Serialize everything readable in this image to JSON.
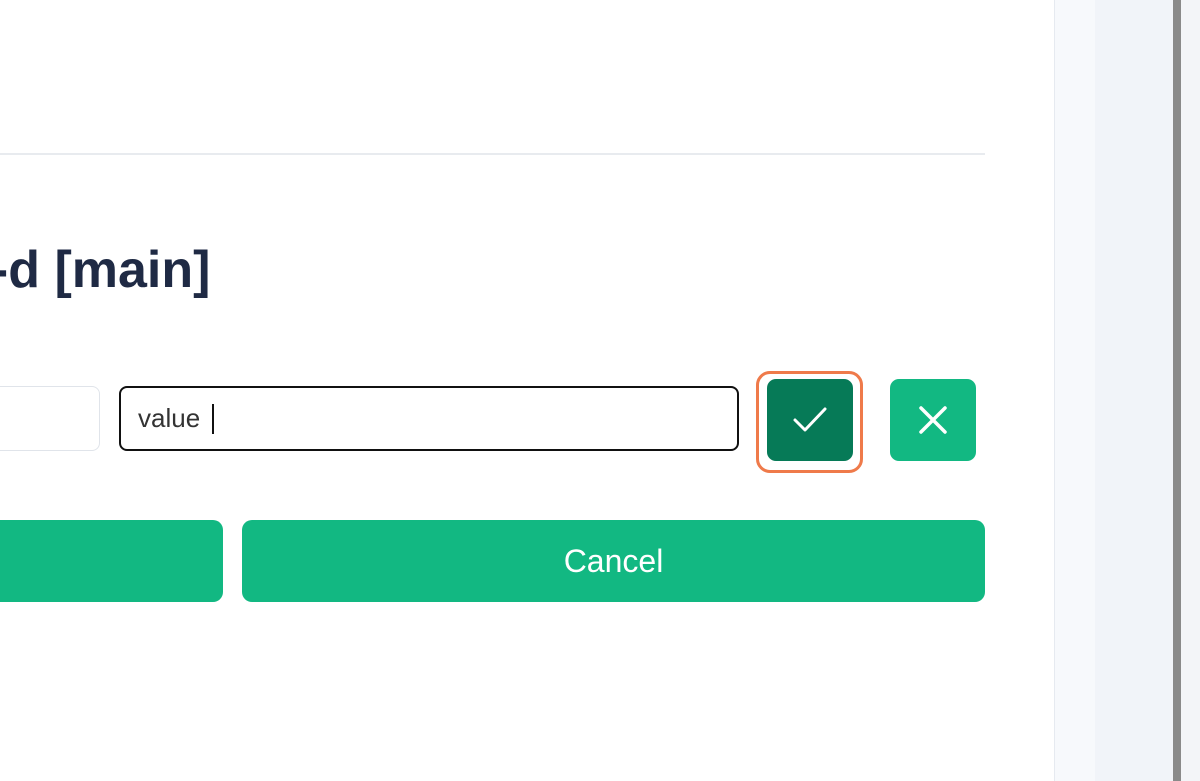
{
  "dialog": {
    "title": "v-d [main]",
    "value_input": {
      "value": "value",
      "placeholder": ""
    },
    "confirm_icon": "check-icon",
    "dismiss_icon": "close-icon",
    "cancel_label": "Cancel"
  },
  "colors": {
    "accent": "#12b882",
    "accent_dark": "#067a57",
    "focus_ring": "#ef7a4a",
    "title_text": "#1f2a44"
  }
}
